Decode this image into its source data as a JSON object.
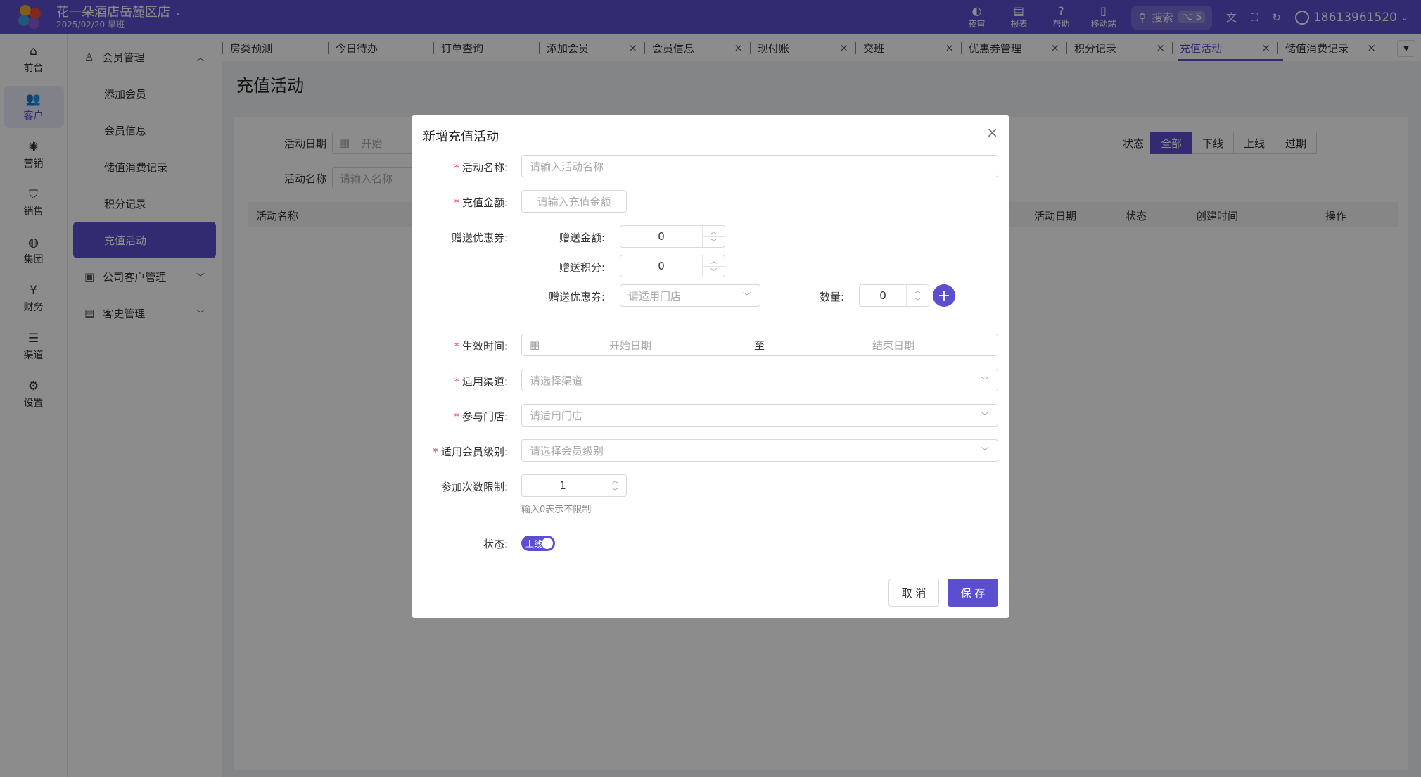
{
  "topbar": {
    "store_name": "花一朵酒店岳麓区店",
    "date_shift": "2025/02/20  早班",
    "tools": [
      {
        "icon": "night-audit-icon",
        "label": "夜审"
      },
      {
        "icon": "report-icon",
        "label": "报表"
      },
      {
        "icon": "help-icon",
        "label": "帮助"
      },
      {
        "icon": "mobile-icon",
        "label": "移动端"
      }
    ],
    "search_label": "搜索",
    "search_shortcut": "⌥ S",
    "user_phone": "18613961520"
  },
  "iconnav": {
    "items": [
      {
        "label": "前台",
        "icon": "frontdesk-icon"
      },
      {
        "label": "客户",
        "icon": "customers-icon",
        "active": true
      },
      {
        "label": "营销",
        "icon": "marketing-icon"
      },
      {
        "label": "销售",
        "icon": "sales-icon"
      },
      {
        "label": "集团",
        "icon": "group-icon"
      },
      {
        "label": "财务",
        "icon": "finance-icon"
      },
      {
        "label": "渠道",
        "icon": "channel-icon"
      },
      {
        "label": "设置",
        "icon": "settings-icon"
      }
    ]
  },
  "sidebar": {
    "group1": "会员管理",
    "items": [
      "添加会员",
      "会员信息",
      "储值消费记录",
      "积分记录",
      "充值活动"
    ],
    "group2": "公司客户管理",
    "group3": "客史管理"
  },
  "tabs": [
    {
      "label": "房类预测",
      "closable": false
    },
    {
      "label": "今日待办",
      "closable": false
    },
    {
      "label": "订单查询",
      "closable": false
    },
    {
      "label": "添加会员",
      "closable": true
    },
    {
      "label": "会员信息",
      "closable": true
    },
    {
      "label": "现付账",
      "closable": true
    },
    {
      "label": "交班",
      "closable": true
    },
    {
      "label": "优惠券管理",
      "closable": true
    },
    {
      "label": "积分记录",
      "closable": true
    },
    {
      "label": "充值活动",
      "closable": true,
      "active": true
    },
    {
      "label": "储值消费记录",
      "closable": true
    }
  ],
  "page": {
    "title": "充值活动",
    "filter_date_label": "活动日期",
    "filter_date_start": "开始",
    "filter_name_label": "活动名称",
    "filter_name_placeholder": "请输入名称",
    "status_label": "状态",
    "status_options": [
      "全部",
      "下线",
      "上线",
      "过期"
    ],
    "table_headers": [
      "活动名称",
      "活动日期",
      "状态",
      "创建时间",
      "操作"
    ]
  },
  "modal": {
    "title": "新增充值活动",
    "activity_name_label": "活动名称:",
    "activity_name_placeholder": "请输入活动名称",
    "amount_label": "充值金额:",
    "amount_placeholder": "请输入充值金额",
    "gift_label": "赠送优惠券:",
    "gift_amount_label": "赠送金额:",
    "gift_amount_value": "0",
    "gift_points_label": "赠送积分:",
    "gift_points_value": "0",
    "gift_coupon_label": "赠送优惠券:",
    "gift_coupon_placeholder": "请适用门店",
    "qty_label": "数量:",
    "qty_value": "0",
    "effective_label": "生效时间:",
    "start_date_placeholder": "开始日期",
    "range_sep": "至",
    "end_date_placeholder": "结束日期",
    "channel_label": "适用渠道:",
    "channel_placeholder": "请选择渠道",
    "store_label": "参与门店:",
    "store_placeholder": "请适用门店",
    "level_label": "适用会员级别:",
    "level_placeholder": "请选择会员级别",
    "limit_label": "参加次数限制:",
    "limit_value": "1",
    "limit_hint": "输入0表示不限制",
    "status_label": "状态:",
    "status_toggle": "上线",
    "cancel": "取 消",
    "save": "保 存"
  }
}
